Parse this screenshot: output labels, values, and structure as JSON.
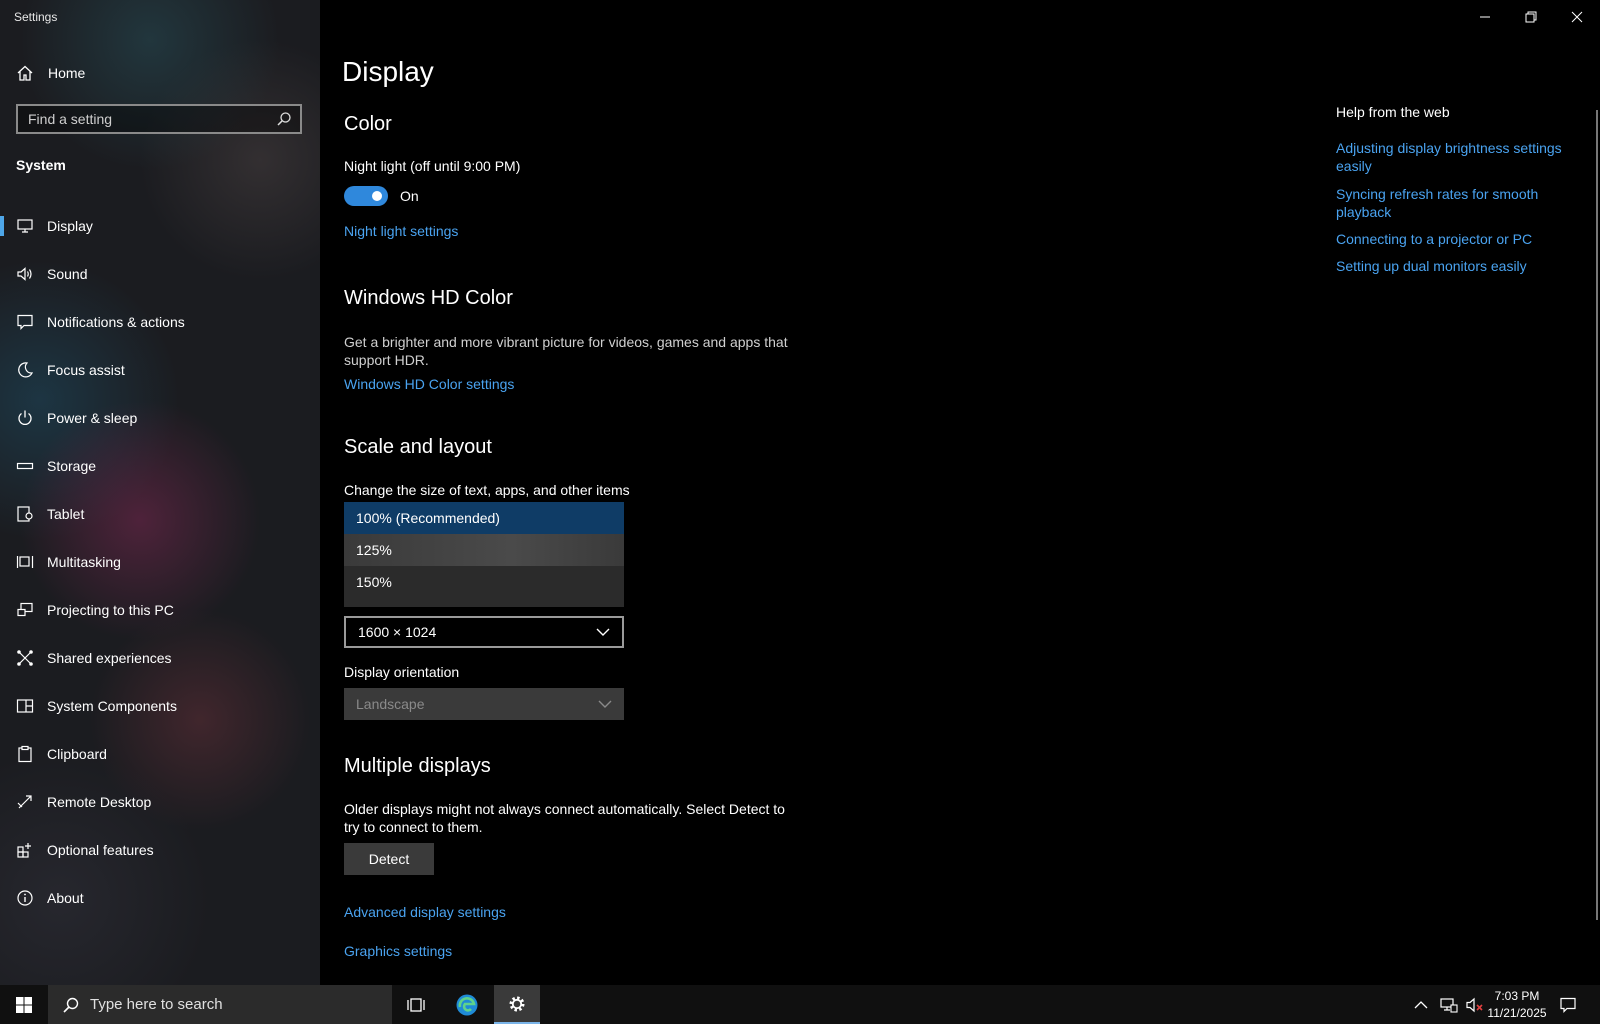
{
  "app": {
    "title": "Settings"
  },
  "sidebar": {
    "home_label": "Home",
    "search_placeholder": "Find a setting",
    "section": "System",
    "items": [
      {
        "label": "Display",
        "icon": "monitor-icon",
        "active": true
      },
      {
        "label": "Sound",
        "icon": "speaker-icon"
      },
      {
        "label": "Notifications & actions",
        "icon": "notification-icon"
      },
      {
        "label": "Focus assist",
        "icon": "moon-icon"
      },
      {
        "label": "Power & sleep",
        "icon": "power-icon"
      },
      {
        "label": "Storage",
        "icon": "storage-icon"
      },
      {
        "label": "Tablet",
        "icon": "tablet-icon"
      },
      {
        "label": "Multitasking",
        "icon": "multitasking-icon"
      },
      {
        "label": "Projecting to this PC",
        "icon": "projecting-icon"
      },
      {
        "label": "Shared experiences",
        "icon": "shared-icon"
      },
      {
        "label": "System Components",
        "icon": "components-icon"
      },
      {
        "label": "Clipboard",
        "icon": "clipboard-icon"
      },
      {
        "label": "Remote Desktop",
        "icon": "remote-desktop-icon"
      },
      {
        "label": "Optional features",
        "icon": "optional-features-icon"
      },
      {
        "label": "About",
        "icon": "info-icon"
      }
    ]
  },
  "main": {
    "title": "Display",
    "color": {
      "heading": "Color",
      "night_light_label": "Night light (off until 9:00 PM)",
      "toggle_state": "On",
      "night_light_link": "Night light settings"
    },
    "hdr": {
      "heading": "Windows HD Color",
      "description": "Get a brighter and more vibrant picture for videos, games and apps that support HDR.",
      "link": "Windows HD Color settings"
    },
    "scale": {
      "heading": "Scale and layout",
      "change_label": "Change the size of text, apps, and other items",
      "options": [
        "100% (Recommended)",
        "125%",
        "150%"
      ],
      "selected_option": "100% (Recommended)",
      "resolution_value": "1600 × 1024",
      "orientation_label": "Display orientation",
      "orientation_value": "Landscape"
    },
    "multiple": {
      "heading": "Multiple displays",
      "description": "Older displays might not always connect automatically. Select Detect to try to connect to them.",
      "detect_button": "Detect",
      "advanced_link": "Advanced display settings",
      "graphics_link": "Graphics settings"
    }
  },
  "help": {
    "title": "Help from the web",
    "links": [
      "Adjusting display brightness settings easily",
      "Syncing refresh rates for smooth playback",
      "Connecting to a projector or PC",
      "Setting up dual monitors easily"
    ]
  },
  "taskbar": {
    "search_placeholder": "Type here to search",
    "time": "7:03 PM",
    "date": "11/21/2025"
  },
  "colors": {
    "accent": "#4aa3f0",
    "toggle": "#2f88dc",
    "selected_option": "#0f3c66"
  }
}
